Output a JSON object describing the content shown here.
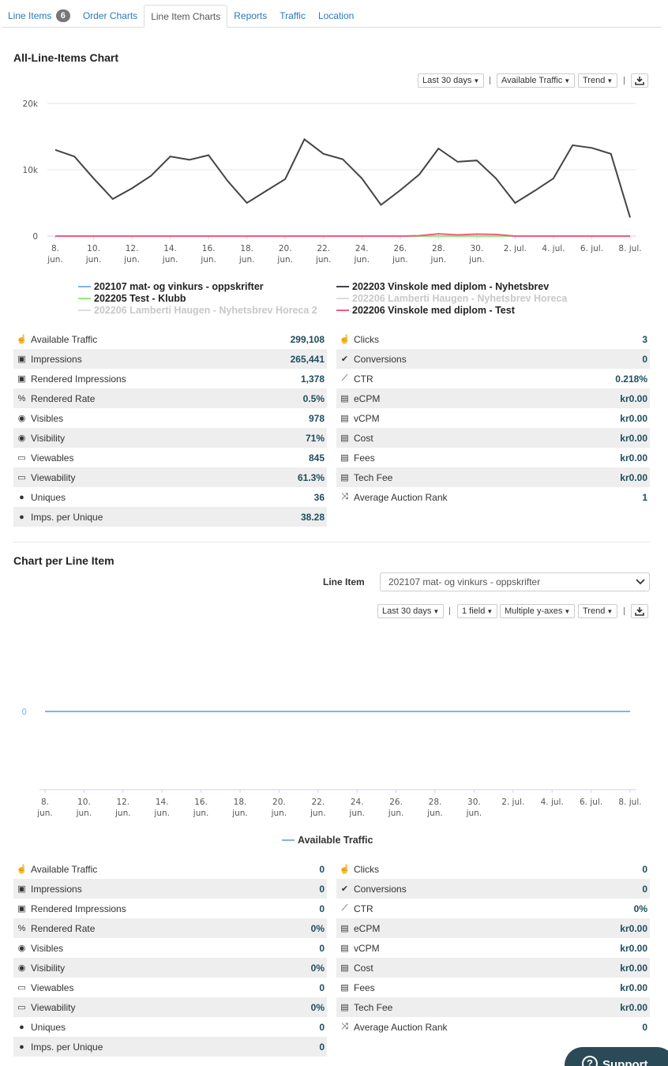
{
  "tabs": [
    {
      "label": "Line Items",
      "badge": "6"
    },
    {
      "label": "Order Charts"
    },
    {
      "label": "Line Item Charts",
      "active": true
    },
    {
      "label": "Reports"
    },
    {
      "label": "Traffic"
    },
    {
      "label": "Location"
    }
  ],
  "all_chart": {
    "title": "All-Line-Items Chart",
    "range_label": "Last 30 days",
    "metric_label": "Available Traffic",
    "mode_label": "Trend"
  },
  "chart_data": [
    {
      "type": "line",
      "x": [
        "8. jun.",
        "9",
        "10. jun.",
        "11",
        "12. jun.",
        "13",
        "14. jun.",
        "15",
        "16. jun.",
        "17",
        "18. jun.",
        "19",
        "20. jun.",
        "21",
        "22. jun.",
        "23",
        "24. jun.",
        "25",
        "26. jun.",
        "27",
        "28. jun.",
        "29",
        "30. jun.",
        "1",
        "2. jul.",
        "3",
        "4. jul.",
        "5",
        "6. jul.",
        "7",
        "8. jul."
      ],
      "x_tick_labels": [
        "8. jun.",
        "10. jun.",
        "12. jun.",
        "14. jun.",
        "16. jun.",
        "18. jun.",
        "20. jun.",
        "22. jun.",
        "24. jun.",
        "26. jun.",
        "28. jun.",
        "30. jun.",
        "2. jul.",
        "4. jul.",
        "6. jul.",
        "8. jul."
      ],
      "y_ticks": [
        "0",
        "10k",
        "20k"
      ],
      "ylim": [
        0,
        20000
      ],
      "series": [
        {
          "name": "202107 mat- og vinkurs - oppskrifter",
          "color": "#7cb5ec",
          "values": [
            0,
            0,
            0,
            0,
            0,
            0,
            0,
            0,
            0,
            0,
            0,
            0,
            0,
            0,
            0,
            0,
            0,
            0,
            0,
            0,
            0,
            0,
            0,
            0,
            0,
            0,
            0,
            0,
            0,
            0,
            0
          ]
        },
        {
          "name": "202203 Vinskole med diplom - Nyhetsbrev",
          "color": "#434348",
          "values": [
            13000,
            12000,
            8700,
            5600,
            7200,
            9100,
            12000,
            11500,
            12200,
            8300,
            5000,
            6800,
            8600,
            14600,
            12400,
            11600,
            8700,
            4700,
            6900,
            9300,
            13200,
            11200,
            11400,
            8700,
            5000,
            6800,
            8700,
            13700,
            13300,
            12400,
            2800
          ]
        },
        {
          "name": "202205 Test - Klubb",
          "color": "#90ed7d",
          "values": [
            0,
            0,
            0,
            0,
            0,
            0,
            0,
            0,
            0,
            0,
            0,
            0,
            0,
            0,
            0,
            0,
            0,
            0,
            0,
            0,
            0,
            0,
            0,
            0,
            0,
            0,
            0,
            0,
            0,
            0,
            0
          ]
        },
        {
          "name": "202206 Lamberti Haugen - Nyhetsbrev Horeca",
          "color": "#c8c8c8",
          "hidden": true,
          "values": []
        },
        {
          "name": "202206 Lamberti Haugen - Nyhetsbrev Horeca 2",
          "color": "#c8c8c8",
          "hidden": true,
          "values": []
        },
        {
          "name": "202206 Vinskole med diplom - Test",
          "color": "#f15c80",
          "values": [
            0,
            0,
            0,
            0,
            0,
            0,
            0,
            0,
            0,
            0,
            0,
            0,
            0,
            0,
            0,
            0,
            0,
            0,
            0,
            60,
            350,
            180,
            300,
            250,
            0,
            0,
            0,
            0,
            0,
            0,
            0
          ]
        }
      ],
      "legend_position": "bottom",
      "grid": true
    },
    {
      "type": "line",
      "x_tick_labels": [
        "8. jun.",
        "10. jun.",
        "12. jun.",
        "14. jun.",
        "16. jun.",
        "18. jun.",
        "20. jun.",
        "22. jun.",
        "24. jun.",
        "26. jun.",
        "28. jun.",
        "30. jun.",
        "2. jul.",
        "4. jul.",
        "6. jul.",
        "8. jul."
      ],
      "y_ticks": [
        "0"
      ],
      "series": [
        {
          "name": "Available Traffic",
          "color": "#7cb5ec",
          "values": [
            0,
            0,
            0,
            0,
            0,
            0,
            0,
            0,
            0,
            0,
            0,
            0,
            0,
            0,
            0,
            0,
            0,
            0,
            0,
            0,
            0,
            0,
            0,
            0,
            0,
            0,
            0,
            0,
            0,
            0,
            0
          ]
        }
      ],
      "legend_position": "bottom"
    }
  ],
  "stats1": {
    "left": [
      {
        "icon": "hand-icon",
        "glyph": "☝",
        "label": "Available Traffic",
        "value": "299,108"
      },
      {
        "icon": "image-icon",
        "glyph": "▣",
        "label": "Impressions",
        "value": "265,441"
      },
      {
        "icon": "image-icon",
        "glyph": "▣",
        "label": "Rendered Impressions",
        "value": "1,378"
      },
      {
        "icon": "percent-icon",
        "glyph": "%",
        "label": "Rendered Rate",
        "value": "0.5%"
      },
      {
        "icon": "eye-icon",
        "glyph": "◉",
        "label": "Visibles",
        "value": "978"
      },
      {
        "icon": "eye-icon",
        "glyph": "◉",
        "label": "Visibility",
        "value": "71%"
      },
      {
        "icon": "monitor-icon",
        "glyph": "▭",
        "label": "Viewables",
        "value": "845"
      },
      {
        "icon": "monitor-icon",
        "glyph": "▭",
        "label": "Viewability",
        "value": "61.3%"
      },
      {
        "icon": "user-icon",
        "glyph": "●",
        "label": "Uniques",
        "value": "36"
      },
      {
        "icon": "user-icon",
        "glyph": "●",
        "label": "Imps. per Unique",
        "value": "38.28"
      }
    ],
    "right": [
      {
        "icon": "pointer-icon",
        "glyph": "☝",
        "label": "Clicks",
        "value": "3"
      },
      {
        "icon": "check-icon",
        "glyph": "✔",
        "label": "Conversions",
        "value": "0"
      },
      {
        "icon": "line-chart-icon",
        "glyph": "⟋",
        "label": "CTR",
        "value": "0.218%"
      },
      {
        "icon": "money-icon",
        "glyph": "▤",
        "label": "eCPM",
        "value": "kr0.00"
      },
      {
        "icon": "money-icon",
        "glyph": "▤",
        "label": "vCPM",
        "value": "kr0.00"
      },
      {
        "icon": "money-icon",
        "glyph": "▤",
        "label": "Cost",
        "value": "kr0.00"
      },
      {
        "icon": "money-icon",
        "glyph": "▤",
        "label": "Fees",
        "value": "kr0.00"
      },
      {
        "icon": "money-icon",
        "glyph": "▤",
        "label": "Tech Fee",
        "value": "kr0.00"
      },
      {
        "icon": "shuffle-icon",
        "glyph": "⤨",
        "label": "Average Auction Rank",
        "value": "1"
      }
    ]
  },
  "per_item": {
    "title": "Chart per Line Item",
    "select_label": "Line Item",
    "select_value": "202107 mat- og vinkurs - oppskrifter",
    "range_label": "Last 30 days",
    "field_label": "1 field",
    "axes_label": "Multiple y-axes",
    "mode_label": "Trend"
  },
  "stats2": {
    "left": [
      {
        "icon": "hand-icon",
        "glyph": "☝",
        "label": "Available Traffic",
        "value": "0"
      },
      {
        "icon": "image-icon",
        "glyph": "▣",
        "label": "Impressions",
        "value": "0"
      },
      {
        "icon": "image-icon",
        "glyph": "▣",
        "label": "Rendered Impressions",
        "value": "0"
      },
      {
        "icon": "percent-icon",
        "glyph": "%",
        "label": "Rendered Rate",
        "value": "0%"
      },
      {
        "icon": "eye-icon",
        "glyph": "◉",
        "label": "Visibles",
        "value": "0"
      },
      {
        "icon": "eye-icon",
        "glyph": "◉",
        "label": "Visibility",
        "value": "0%"
      },
      {
        "icon": "monitor-icon",
        "glyph": "▭",
        "label": "Viewables",
        "value": "0"
      },
      {
        "icon": "monitor-icon",
        "glyph": "▭",
        "label": "Viewability",
        "value": "0%"
      },
      {
        "icon": "user-icon",
        "glyph": "●",
        "label": "Uniques",
        "value": "0"
      },
      {
        "icon": "user-icon",
        "glyph": "●",
        "label": "Imps. per Unique",
        "value": "0"
      }
    ],
    "right": [
      {
        "icon": "pointer-icon",
        "glyph": "☝",
        "label": "Clicks",
        "value": "0"
      },
      {
        "icon": "check-icon",
        "glyph": "✔",
        "label": "Conversions",
        "value": "0"
      },
      {
        "icon": "line-chart-icon",
        "glyph": "⟋",
        "label": "CTR",
        "value": "0%"
      },
      {
        "icon": "money-icon",
        "glyph": "▤",
        "label": "eCPM",
        "value": "kr0.00"
      },
      {
        "icon": "money-icon",
        "glyph": "▤",
        "label": "vCPM",
        "value": "kr0.00"
      },
      {
        "icon": "money-icon",
        "glyph": "▤",
        "label": "Cost",
        "value": "kr0.00"
      },
      {
        "icon": "money-icon",
        "glyph": "▤",
        "label": "Fees",
        "value": "kr0.00"
      },
      {
        "icon": "money-icon",
        "glyph": "▤",
        "label": "Tech Fee",
        "value": "kr0.00"
      },
      {
        "icon": "shuffle-icon",
        "glyph": "⤨",
        "label": "Average Auction Rank",
        "value": "0"
      }
    ]
  },
  "support_label": "Support"
}
